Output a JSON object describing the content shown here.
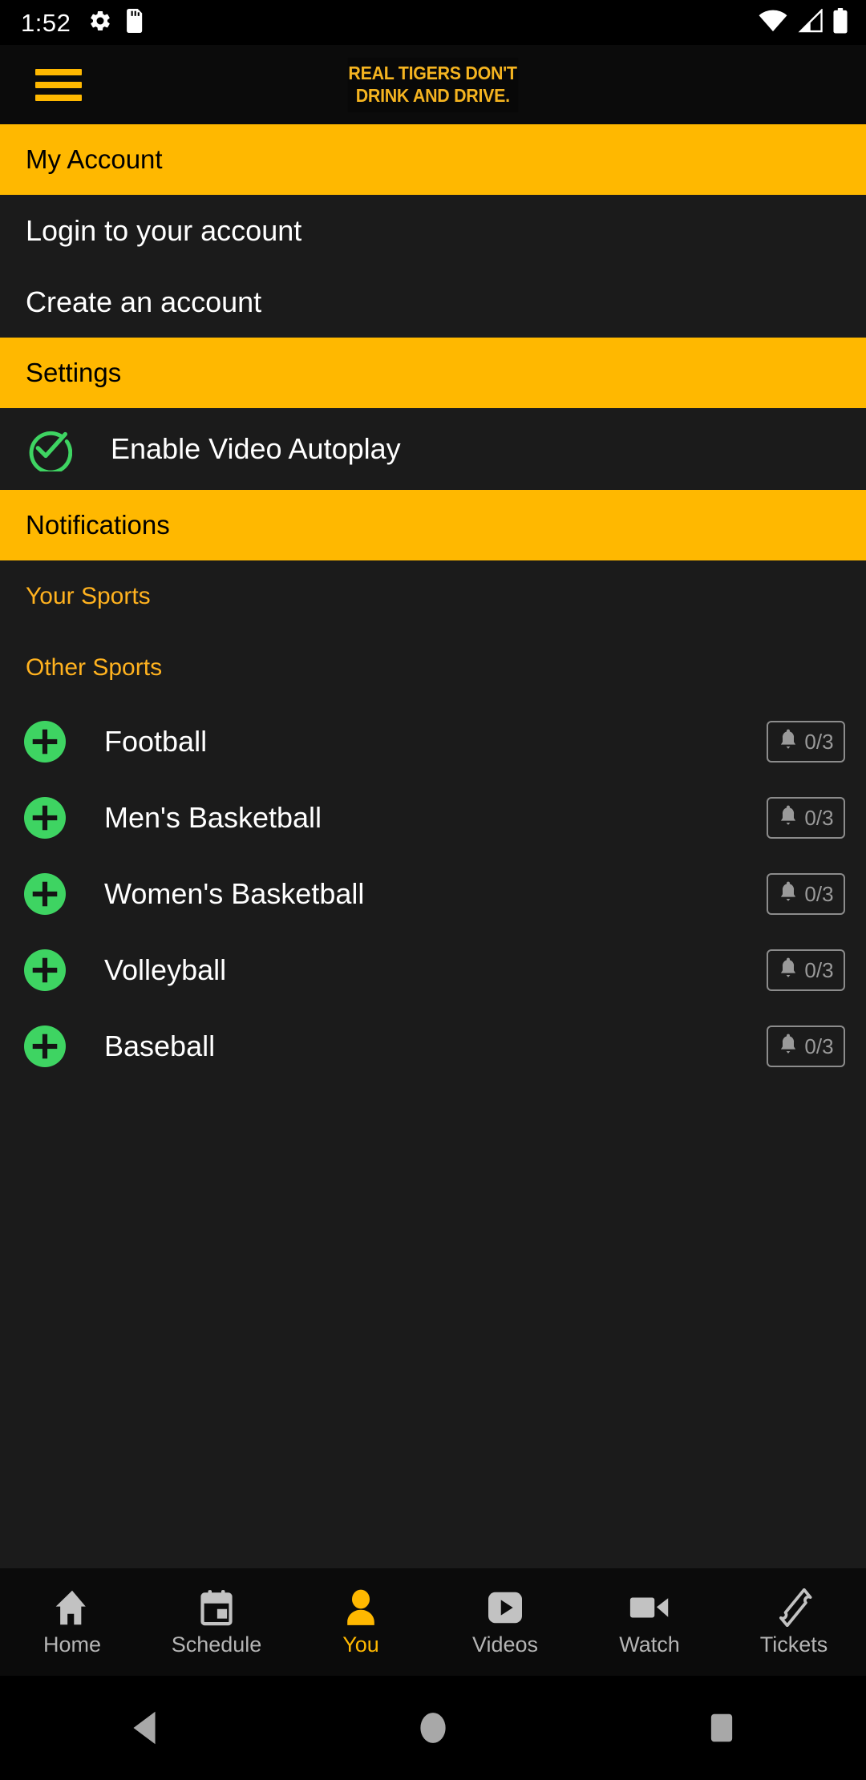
{
  "status_bar": {
    "time": "1:52",
    "left_icons": [
      "gear-icon",
      "sd-card-icon"
    ],
    "right_icons": [
      "wifi-icon",
      "cellular-signal-icon",
      "battery-icon"
    ]
  },
  "app_bar": {
    "menu_icon": "hamburger-menu-icon",
    "banner_line1": "REAL TIGERS DON'T",
    "banner_line2": "DRINK AND DRIVE."
  },
  "menu": {
    "account_section": {
      "title": "My Account",
      "items": [
        {
          "label": "Login to your account"
        },
        {
          "label": "Create an account"
        }
      ]
    },
    "settings_section": {
      "title": "Settings",
      "autoplay": {
        "label": "Enable Video Autoplay",
        "icon": "check-circle-icon",
        "checked": true
      }
    },
    "notifications_section": {
      "title": "Notifications",
      "your_sports_label": "Your Sports",
      "other_sports_label": "Other Sports",
      "sports": [
        {
          "name": "Football",
          "badge": "0/3",
          "add_icon": "plus-circle-icon",
          "bell_icon": "bell-icon"
        },
        {
          "name": "Men's Basketball",
          "badge": "0/3",
          "add_icon": "plus-circle-icon",
          "bell_icon": "bell-icon"
        },
        {
          "name": "Women's Basketball",
          "badge": "0/3",
          "add_icon": "plus-circle-icon",
          "bell_icon": "bell-icon"
        },
        {
          "name": "Volleyball",
          "badge": "0/3",
          "add_icon": "plus-circle-icon",
          "bell_icon": "bell-icon"
        },
        {
          "name": "Baseball",
          "badge": "0/3",
          "add_icon": "plus-circle-icon",
          "bell_icon": "bell-icon"
        }
      ]
    }
  },
  "tab_bar": {
    "active": "You",
    "tabs": [
      {
        "label": "Home",
        "icon": "home-icon"
      },
      {
        "label": "Schedule",
        "icon": "calendar-icon"
      },
      {
        "label": "You",
        "icon": "person-icon"
      },
      {
        "label": "Videos",
        "icon": "play-rect-icon"
      },
      {
        "label": "Watch",
        "icon": "video-camera-icon"
      },
      {
        "label": "Tickets",
        "icon": "ticket-icon"
      }
    ]
  },
  "system_nav": {
    "back": "back-triangle-icon",
    "home": "home-circle-icon",
    "recents": "recents-square-icon"
  },
  "colors": {
    "accent_yellow": "#FFB800",
    "accent_green": "#3ED462",
    "background_dark": "#1B1B1B",
    "bar_black": "#0B0B0B",
    "text_white": "#FFFFFF",
    "text_muted": "#9A9A9A"
  }
}
